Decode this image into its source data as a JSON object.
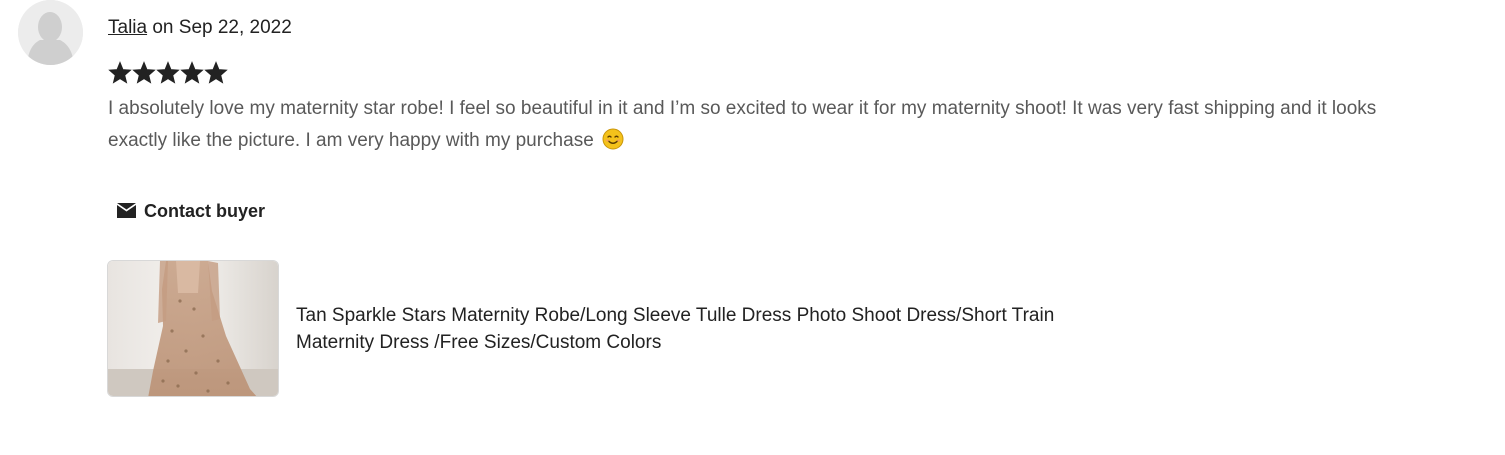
{
  "review": {
    "reviewer_name": "Talia",
    "date_text": " on Sep 22, 2022",
    "rating": 5,
    "rating_max": 5,
    "text": "I absolutely love my maternity star robe! I feel so beautiful in it and I’m so excited to wear it for my maternity shoot! It was very fast shipping and it looks exactly like the picture. I am very happy with my purchase"
  },
  "actions": {
    "contact_label": "Contact buyer"
  },
  "product": {
    "title": "Tan Sparkle Stars Maternity Robe/Long Sleeve Tulle Dress Photo Shoot Dress/Short Train Maternity Dress /Free Sizes/Custom Colors"
  },
  "icons": {
    "avatar": "user-silhouette-icon",
    "star": "star-filled-icon",
    "emoji": "smiling-face-icon",
    "contact": "envelope-icon"
  },
  "colors": {
    "text_primary": "#222222",
    "text_secondary": "#595959",
    "avatar_bg": "#ececec",
    "star": "#222222",
    "emoji": "#f4c21b"
  }
}
